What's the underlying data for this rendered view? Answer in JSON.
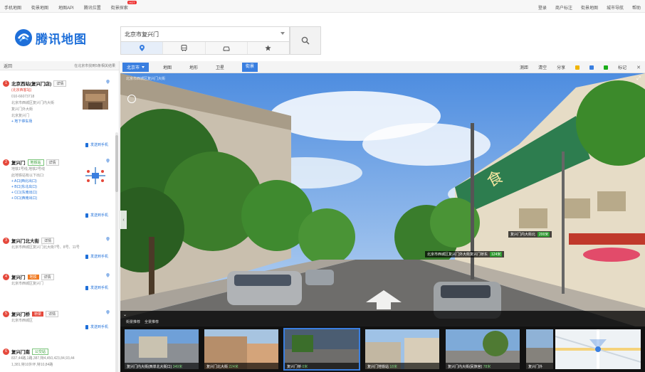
{
  "topnav": {
    "left": [
      "手机地图",
      "街景地图",
      "地图API",
      "腾讯位置",
      "街景探索"
    ],
    "hot_tag": "HOT",
    "right": [
      "登录",
      "商户标注",
      "街景地图",
      "城市导航",
      "帮助"
    ]
  },
  "logo": {
    "text": "腾讯地图"
  },
  "search": {
    "value": "北京市复兴门"
  },
  "results": {
    "back": "返回",
    "summary": "在北京市找到5条相关结果",
    "items": [
      {
        "num": "1",
        "name": "北京西站(复兴门店)",
        "badge": "详情",
        "sub": "(北京西客站)",
        "lines": [
          "010-66073718",
          "北京市西城区复兴门内大街",
          "复兴门外大街",
          "北京复兴门"
        ],
        "link": "+ 地下停车场",
        "action": "发送到手机"
      },
      {
        "num": "2",
        "name": "复兴门",
        "tag": "地铁站",
        "badge": "详情",
        "lines": [
          "地铁1号线,地铁2号线",
          "此地铁站有以下出口:"
        ],
        "links": [
          "+ A口(西北出口)",
          "+ B口(东北出口)",
          "+ C口(东南出口)",
          "+ D口(西南出口)"
        ],
        "action": "发送到手机"
      },
      {
        "num": "3",
        "name": "复兴门北大街",
        "badge": "详情",
        "lines": [
          "北京市西城区复兴门北大街7号、8号、11号"
        ],
        "action": "发送到手机"
      },
      {
        "num": "4",
        "name": "复兴门",
        "tag": "地铁",
        "badge": "详情",
        "lines": [
          "北京市西城区复兴门"
        ],
        "action": "发送到手机"
      },
      {
        "num": "5",
        "name": "复兴门桥",
        "tag": "桥梁",
        "badge": "详情",
        "lines": [
          "北京市西城区"
        ],
        "action": "发送到手机"
      },
      {
        "num": "6",
        "name": "复兴门南",
        "tag": "公交站",
        "lines": [
          "837,44路,1路,387,特4,450,423,84,93,44",
          "1,381,特10外环,特10,84路"
        ]
      }
    ]
  },
  "map": {
    "city": "北京市",
    "tabs": [
      "地图",
      "地形",
      "卫星",
      "街景"
    ],
    "active_tab": "街景",
    "tools": [
      "测距",
      "清空",
      "分享"
    ],
    "tools_right": "标记"
  },
  "street": {
    "caption": "北京市西城区复兴门大街",
    "sign1": {
      "text": "复兴门内大街北",
      "tag": "200米"
    },
    "sign2": {
      "text": "北京市西城区复兴门外大街复兴门桥东",
      "tag": "124米"
    },
    "strip_heading": [
      "街景推荐",
      "全景推荐"
    ],
    "cards": [
      {
        "cap": "复兴门内大街(西单北大街口)",
        "dist": "349米"
      },
      {
        "cap": "复兴门北大街",
        "dist": "224米"
      },
      {
        "cap": "复兴门桥",
        "dist": "0米"
      },
      {
        "cap": "复兴门地铁站",
        "dist": "18米"
      },
      {
        "cap": "复兴门内大街(民族宫)",
        "dist": "78米"
      },
      {
        "cap": "复兴门外",
        "dist": ""
      }
    ]
  }
}
